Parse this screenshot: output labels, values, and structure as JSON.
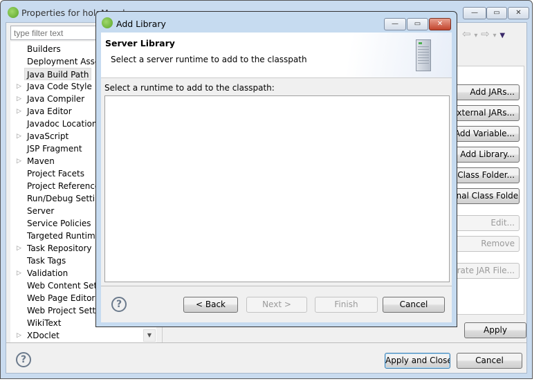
{
  "main_window": {
    "title": "Properties for holaMundo",
    "filter_placeholder": "type filter text",
    "tree_items": [
      {
        "label": "Builders",
        "expandable": false
      },
      {
        "label": "Deployment Assembly",
        "expandable": false
      },
      {
        "label": "Java Build Path",
        "expandable": false,
        "selected": true
      },
      {
        "label": "Java Code Style",
        "expandable": true
      },
      {
        "label": "Java Compiler",
        "expandable": true
      },
      {
        "label": "Java Editor",
        "expandable": true
      },
      {
        "label": "Javadoc Location",
        "expandable": false
      },
      {
        "label": "JavaScript",
        "expandable": true
      },
      {
        "label": "JSP Fragment",
        "expandable": false
      },
      {
        "label": "Maven",
        "expandable": true
      },
      {
        "label": "Project Facets",
        "expandable": false
      },
      {
        "label": "Project References",
        "expandable": false
      },
      {
        "label": "Run/Debug Settings",
        "expandable": false
      },
      {
        "label": "Server",
        "expandable": false
      },
      {
        "label": "Service Policies",
        "expandable": false
      },
      {
        "label": "Targeted Runtimes",
        "expandable": false
      },
      {
        "label": "Task Repository",
        "expandable": true
      },
      {
        "label": "Task Tags",
        "expandable": false
      },
      {
        "label": "Validation",
        "expandable": true
      },
      {
        "label": "Web Content Settings",
        "expandable": false
      },
      {
        "label": "Web Page Editor",
        "expandable": false
      },
      {
        "label": "Web Project Settings",
        "expandable": false
      },
      {
        "label": "WikiText",
        "expandable": false
      },
      {
        "label": "XDoclet",
        "expandable": true
      }
    ],
    "side_buttons": [
      {
        "label": "Add JARs...",
        "enabled": true
      },
      {
        "label": "Add External JARs...",
        "enabled": true
      },
      {
        "label": "Add Variable...",
        "enabled": true
      },
      {
        "label": "Add Library...",
        "enabled": true
      },
      {
        "label": "Add Class Folder...",
        "enabled": true
      },
      {
        "label": "Add External Class Folder...",
        "enabled": true
      },
      {
        "label": "Edit...",
        "enabled": false
      },
      {
        "label": "Remove",
        "enabled": false
      },
      {
        "label": "Migrate JAR File...",
        "enabled": false
      }
    ],
    "apply": "Apply",
    "apply_and_close": "Apply and Close",
    "cancel": "Cancel",
    "nav": {
      "back": "⇦",
      "forward": "⇨",
      "dropdown": "▾",
      "menu": "▼"
    },
    "caption": {
      "minimize": "—",
      "maximize": "▭",
      "close": "✕"
    }
  },
  "dialog": {
    "title": "Add Library",
    "header_title": "Server Library",
    "header_desc": "Select a server runtime to add to the classpath",
    "list_label": "Select a runtime to add to the classpath:",
    "runtimes": [],
    "back": "< Back",
    "next": "Next >",
    "finish": "Finish",
    "cancel": "Cancel",
    "help": "?"
  },
  "colors": {
    "frame": "#c9dbef",
    "accent": "#3c7fb1",
    "close": "#c2432c"
  }
}
